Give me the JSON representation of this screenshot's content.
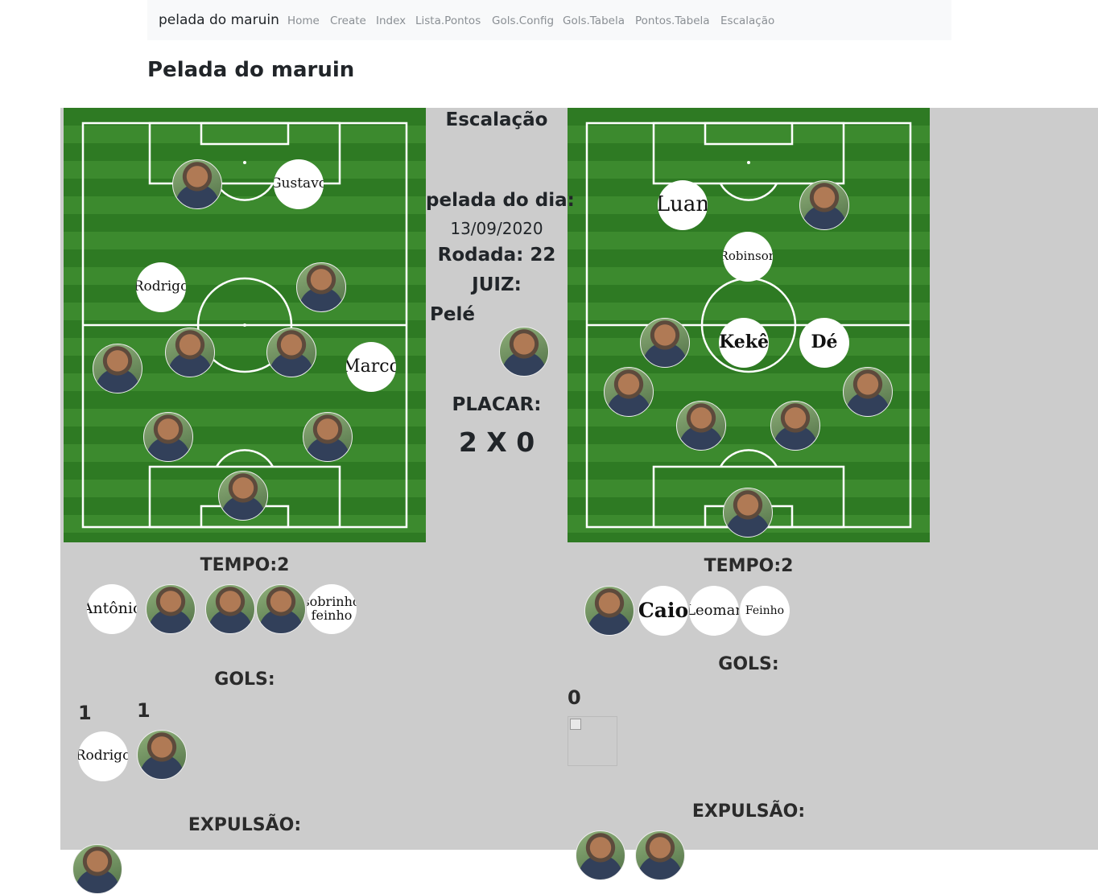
{
  "navbar": {
    "brand": "pelada do maruin",
    "links": [
      "Home",
      "Create",
      "Index",
      "Lista.Pontos",
      "Gols.Config",
      "Gols.Tabela",
      "Pontos.Tabela",
      "Escalação"
    ]
  },
  "page_title": "Pelada do maruin",
  "center": {
    "heading": "Escalação",
    "date_label": "pelada do dia:",
    "date": "13/09/2020",
    "round": "Rodada: 22",
    "referee_label": "JUIZ:",
    "referee_name": "Pelé",
    "score_label": "PLACAR:",
    "score": "2 X 0"
  },
  "team_left": {
    "field_names": {
      "gustavo": "Gustavo",
      "rodrigo": "Rodrigo",
      "marco": "Marco"
    },
    "tempo": "TEMPO:2",
    "subs": {
      "antonio": "Antônio",
      "sobrinho": "sobrinho feinho"
    },
    "gols_label": "GOLS:",
    "goal_counts": [
      "1",
      "1"
    ],
    "goal_scorer": "Rodrigo",
    "expulsao_label": "EXPULSÃO:"
  },
  "team_right": {
    "field_names": {
      "luan": "Luan",
      "robinson": "Robinson",
      "keke": "Kekê",
      "de": "Dé"
    },
    "tempo": "TEMPO:2",
    "subs": {
      "caio": "Caio",
      "leomar": "Leomar",
      "feinho": "Feinho"
    },
    "gols_label": "GOLS:",
    "goal_count": "0",
    "expulsao_label": "EXPULSÃO:"
  }
}
